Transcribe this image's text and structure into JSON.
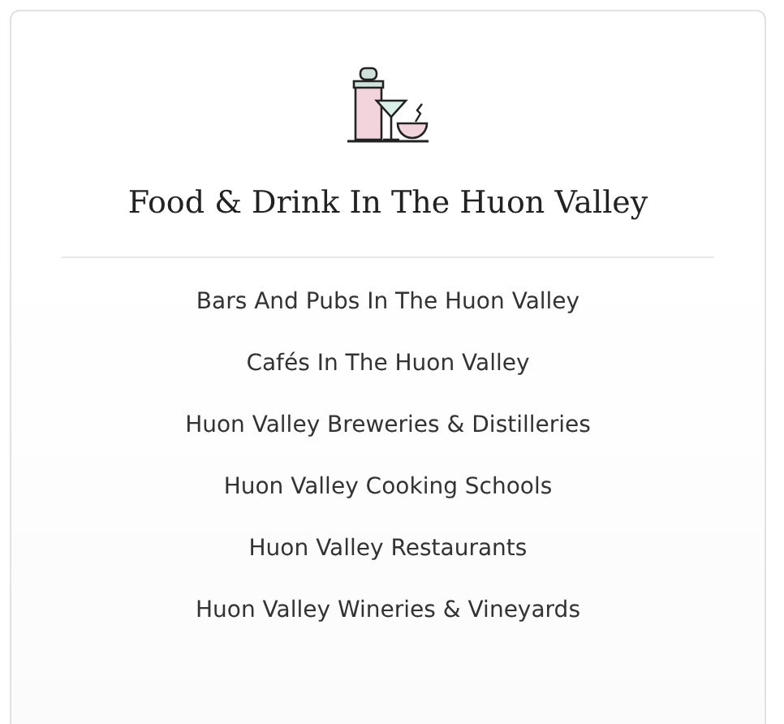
{
  "title": "Food & Drink In The Huon Valley",
  "links": [
    {
      "label": "Bars And Pubs In The Huon Valley"
    },
    {
      "label": "Cafés In The Huon Valley"
    },
    {
      "label": "Huon Valley Breweries & Distilleries"
    },
    {
      "label": "Huon Valley Cooking Schools"
    },
    {
      "label": "Huon Valley Restaurants"
    },
    {
      "label": "Huon Valley Wineries & Vineyards"
    }
  ]
}
